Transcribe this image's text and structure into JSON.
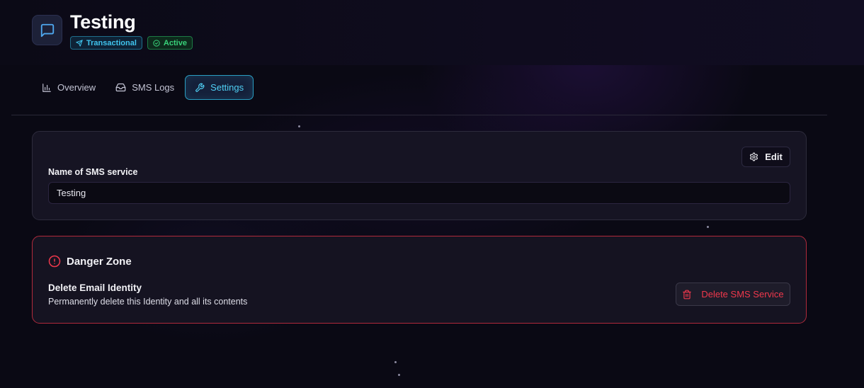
{
  "header": {
    "title": "Testing",
    "app_icon": "message-square-icon",
    "badges": [
      {
        "label": "Transactional",
        "icon": "send-icon",
        "color": "#40c4ee"
      },
      {
        "label": "Active",
        "icon": "check-circle-icon",
        "color": "#39d37a"
      }
    ]
  },
  "tabs": [
    {
      "label": "Overview",
      "icon": "bar-chart-icon",
      "active": false
    },
    {
      "label": "SMS Logs",
      "icon": "inbox-icon",
      "active": false
    },
    {
      "label": "Settings",
      "icon": "wrench-icon",
      "active": true
    }
  ],
  "settings_card": {
    "edit_label": "Edit",
    "field_label": "Name of SMS service",
    "field_value": "Testing"
  },
  "danger_zone": {
    "title": "Danger Zone",
    "item_title": "Delete Email Identity",
    "item_description": "Permanently delete this Identity and all its contents",
    "delete_label": "Delete SMS Service",
    "accent": "#f0384c"
  },
  "colors": {
    "background": "#0a0914",
    "accent": "#4fd0f5",
    "danger": "#b02a3c"
  }
}
